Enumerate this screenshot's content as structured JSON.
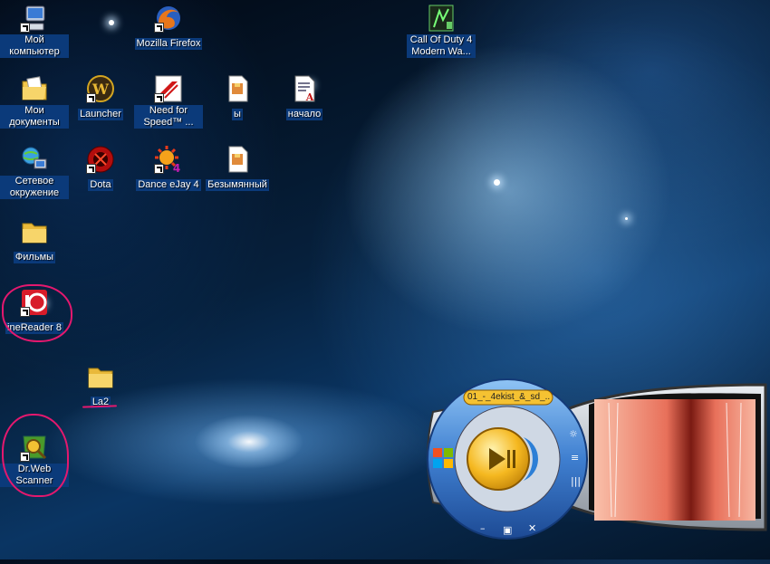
{
  "desktop": {
    "icons": [
      {
        "key": "my_computer",
        "label": "Мой компьютер",
        "icon": "computer-icon",
        "shortcut": false
      },
      {
        "key": "firefox",
        "label": "Mozilla Firefox",
        "icon": "firefox-icon",
        "shortcut": true
      },
      {
        "key": "cod4",
        "label": "Call Of Duty 4 Modern Wa...",
        "icon": "cod4-icon",
        "shortcut": false
      },
      {
        "key": "my_documents",
        "label": "Мои документы",
        "icon": "documents-folder-icon",
        "shortcut": false
      },
      {
        "key": "launcher",
        "label": "Launcher",
        "icon": "wow-launcher-icon",
        "shortcut": true
      },
      {
        "key": "nfs",
        "label": "Need for Speed™ ...",
        "icon": "nfs-icon",
        "shortcut": true
      },
      {
        "key": "y",
        "label": "ы",
        "icon": "archive-file-icon",
        "shortcut": false
      },
      {
        "key": "nachalo",
        "label": "начало",
        "icon": "text-document-icon",
        "shortcut": false
      },
      {
        "key": "network",
        "label": "Сетевое окружение",
        "icon": "network-icon",
        "shortcut": false
      },
      {
        "key": "dota",
        "label": "Dota",
        "icon": "dota-icon",
        "shortcut": true
      },
      {
        "key": "dance_ejay",
        "label": "Dance eJay 4",
        "icon": "dance-ejay-icon",
        "shortcut": true
      },
      {
        "key": "untitled",
        "label": "Безымянный",
        "icon": "archive-file-icon",
        "shortcut": false
      },
      {
        "key": "filmy",
        "label": "Фильмы",
        "icon": "folder-icon",
        "shortcut": false
      },
      {
        "key": "finereader",
        "label": "ineReader 8",
        "icon": "finereader-icon",
        "shortcut": true
      },
      {
        "key": "la2",
        "label": "La2",
        "icon": "folder-icon",
        "shortcut": false
      },
      {
        "key": "drweb",
        "label": "Dr.Web Scanner",
        "icon": "drweb-icon",
        "shortcut": true
      }
    ]
  },
  "media_player": {
    "track_title": "01_-_4ekist_&_sd_...",
    "colors": {
      "ring": "#3f7fd0",
      "play": "#f5b820",
      "visualizer": "#e8705a",
      "frame": "#c0c0c0"
    }
  },
  "annotations": {
    "color": "#e4186e"
  }
}
